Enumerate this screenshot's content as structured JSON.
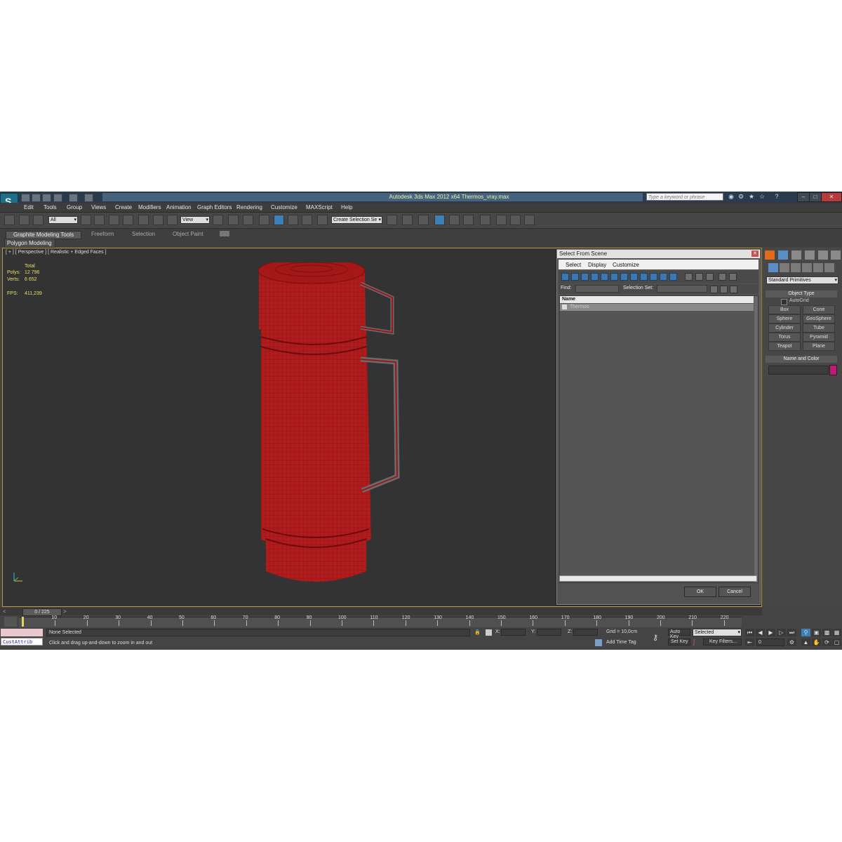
{
  "window": {
    "title": "Autodesk 3ds Max  2012 x64      Thermos_vray.max",
    "search_placeholder": "Type a keyword or phrase",
    "logo_glyph": "S"
  },
  "menu": [
    "Edit",
    "Tools",
    "Group",
    "Views",
    "Create",
    "Modifiers",
    "Animation",
    "Graph Editors",
    "Rendering",
    "Customize",
    "MAXScript",
    "Help"
  ],
  "toolbar": {
    "filter_value": "All",
    "ref_coord_value": "View",
    "selection_set_value": "Create Selection Se"
  },
  "ribbon": {
    "tabs": [
      "Graphite Modeling Tools",
      "Freeform",
      "Selection",
      "Object Paint"
    ],
    "panel": "Polygon Modeling"
  },
  "viewport": {
    "label": "[ + ] [ Perspective ] [ Realistic + Edged Faces ]",
    "stats_header": "Total",
    "polys_label": "Polys:",
    "polys_value": "12 796",
    "verts_label": "Verts:",
    "verts_value": "6 652",
    "fps_label": "FPS:",
    "fps_value": "411,239",
    "object_color": "#b01c1c",
    "wire_color": "#7a1010"
  },
  "dialog": {
    "title": "Select From Scene",
    "menu": [
      "Select",
      "Display",
      "Customize"
    ],
    "find_label": "Find:",
    "selection_set_label": "Selection Set:",
    "column_name": "Name",
    "rows": [
      "Thermos"
    ],
    "ok": "OK",
    "cancel": "Cancel"
  },
  "command_panel": {
    "category": "Standard Primitives",
    "object_type_header": "Object Type",
    "autogrid": "AutoGrid",
    "buttons": [
      "Box",
      "Cone",
      "Sphere",
      "GeoSphere",
      "Cylinder",
      "Tube",
      "Torus",
      "Pyramid",
      "Teapot",
      "Plane"
    ],
    "name_color_header": "Name and Color",
    "swatch_color": "#c0177a"
  },
  "timeline": {
    "frame_display": "0 / 225",
    "ticks": [
      "10",
      "20",
      "30",
      "40",
      "50",
      "60",
      "70",
      "80",
      "90",
      "100",
      "110",
      "120",
      "130",
      "140",
      "150",
      "160",
      "170",
      "180",
      "190",
      "200",
      "210",
      "220"
    ]
  },
  "status": {
    "custattrib": "CustAttrib",
    "selection": "None Selected",
    "prompt": "Click and drag up-and-down to zoom in and out",
    "x_label": "X:",
    "y_label": "Y:",
    "z_label": "Z:",
    "grid": "Grid = 10,0cm",
    "add_time_tag": "Add Time Tag",
    "auto_key": "Auto Key",
    "auto_key_value": "Selected",
    "set_key": "Set Key",
    "key_filters": "Key Filters...",
    "frame_value": "0"
  }
}
